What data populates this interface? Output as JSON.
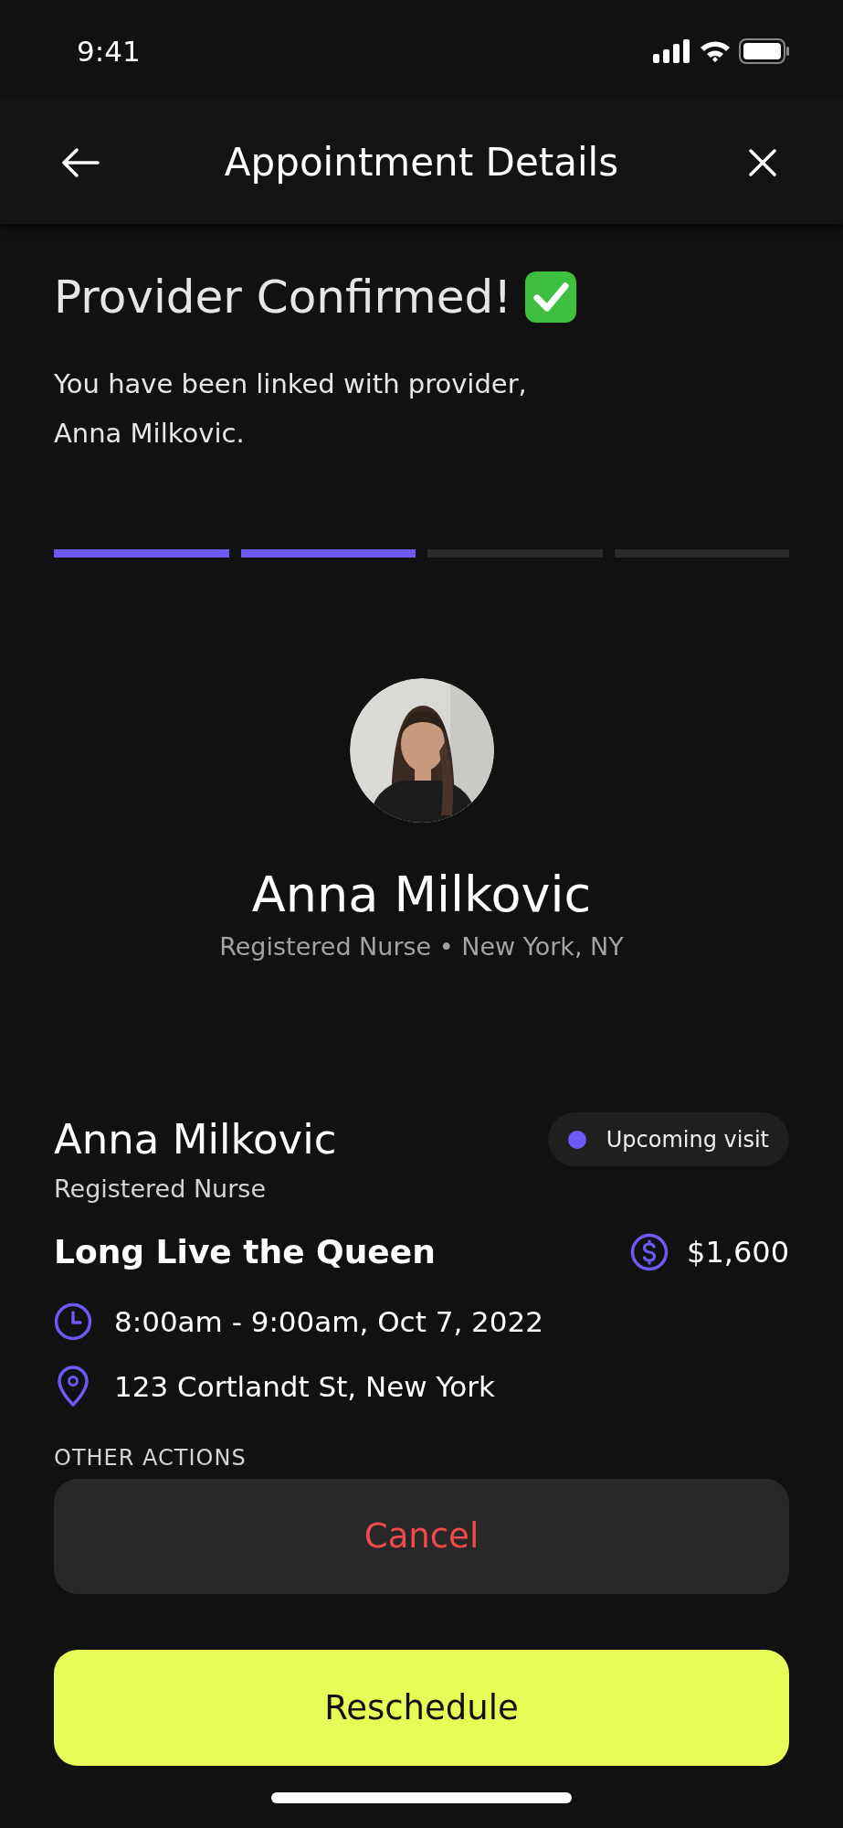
{
  "status_bar": {
    "time": "9:41"
  },
  "nav": {
    "title": "Appointment Details"
  },
  "header": {
    "title": "Provider Confirmed!",
    "message": "You have been linked with provider, Anna Milkovic."
  },
  "progress": [
    {
      "completed": true
    },
    {
      "completed": true
    },
    {
      "completed": false
    },
    {
      "completed": false
    }
  ],
  "provider": {
    "name": "Anna Milkovic",
    "subtitle": "Registered Nurse • New York, NY"
  },
  "appointment": {
    "provider_name": "Anna Milkovic",
    "role": "Registered Nurse",
    "status": {
      "label": "Upcoming visit",
      "color": "#6d5af6"
    },
    "title": "Long Live the Queen",
    "price": "$1,600",
    "time": "8:00am - 9:00am, Oct 7, 2022",
    "address": "123 Cortlandt St, New York"
  },
  "other_actions": {
    "label": "OTHER ACTIONS"
  },
  "buttons": [
    {
      "kind": "secondary",
      "label": "Cancel"
    },
    {
      "kind": "primary",
      "label": "Reschedule"
    }
  ]
}
